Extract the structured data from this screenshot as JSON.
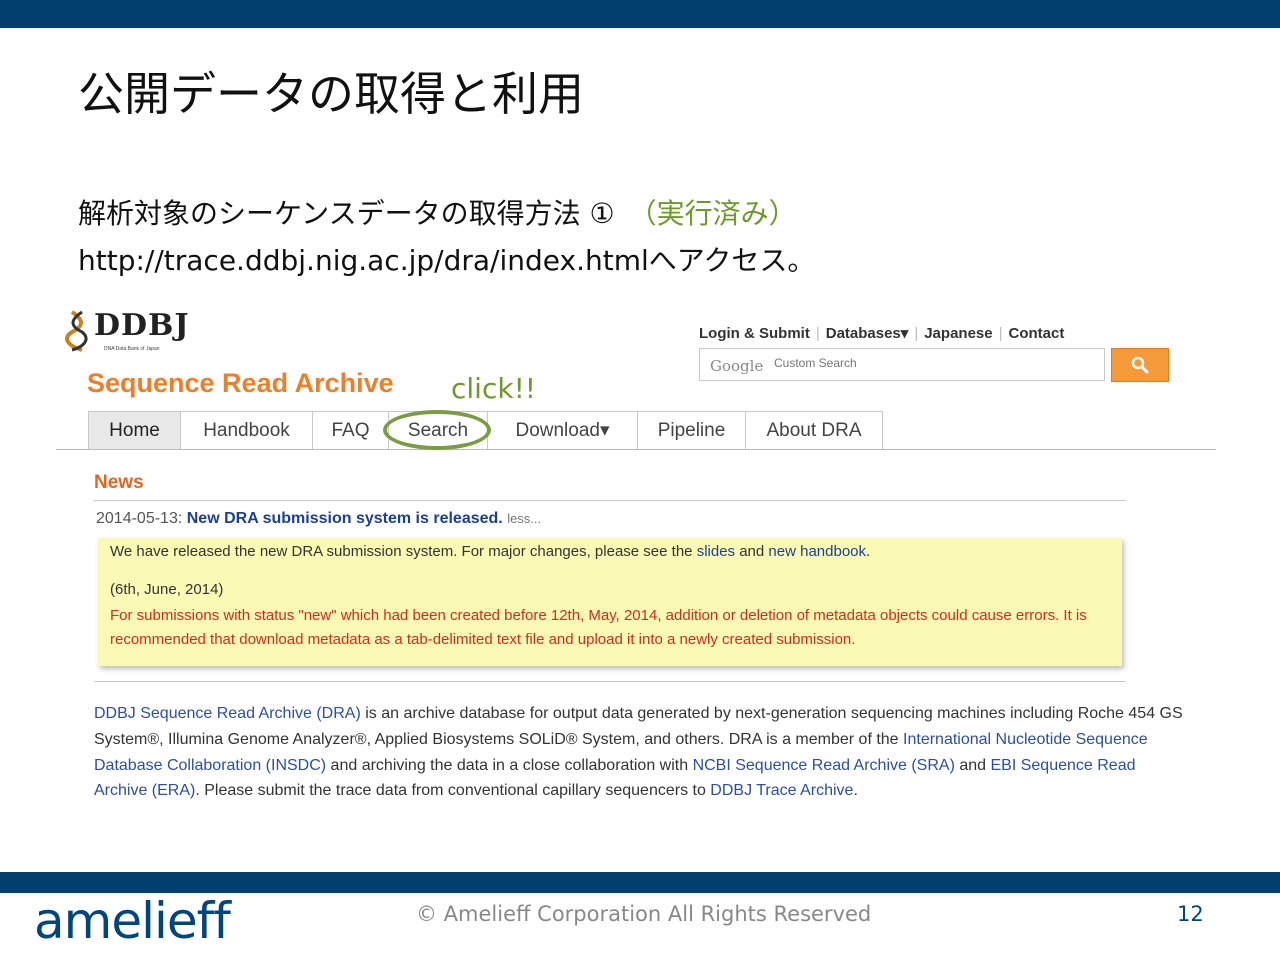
{
  "slide": {
    "title": "公開データの取得と利用",
    "subtitle_main": "解析対象のシーケンスデータの取得方法 ①　",
    "subtitle_note": "（実行済み）",
    "url_line": "http://trace.ddbj.nig.ac.jp/dra/index.htmlへアクセス。",
    "annotation": "click!!"
  },
  "site": {
    "logo_text": "DDBJ",
    "logo_sub": "DNA Data Bank of Japan",
    "top_nav": [
      "Login & Submit",
      "Databases▾",
      "Japanese",
      "Contact"
    ],
    "search": {
      "google_label": "Google",
      "placeholder": "Custom Search"
    },
    "section_title": "Sequence Read Archive",
    "tabs": [
      "Home",
      "Handbook",
      "FAQ",
      "Search",
      "Download▾",
      "Pipeline",
      "About DRA"
    ],
    "news": {
      "heading": "News",
      "date": "2014-05-13:",
      "headline": "New DRA submission system is released.",
      "less": "less...",
      "notice_p1_a": "We have released the new DRA submission system. For major changes, please see the ",
      "notice_link1": "slides",
      "notice_p1_b": " and ",
      "notice_link2": "new handbook",
      "notice_p1_c": ".",
      "notice_date": "(6th, June, 2014)",
      "notice_warning": "For submissions with status \"new\" which had been created before 12th, May, 2014, addition or deletion of metadata objects could cause errors. It is recommended that download metadata as a tab-delimited text file and upload it into a newly created submission."
    },
    "about": {
      "link_dra": "DDBJ Sequence Read Archive (DRA)",
      "t1": " is an archive database for output data generated by next-generation sequencing machines including Roche 454 GS System®, Illumina Genome Analyzer®, Applied Biosystems SOLiD® System, and others. DRA is a member of the ",
      "link_insdc": "International Nucleotide Sequence Database Collaboration (INSDC)",
      "t2": " and archiving the data in a close collaboration with ",
      "link_sra": "NCBI Sequence Read Archive (SRA)",
      "t3": " and ",
      "link_era": "EBI Sequence Read Archive (ERA)",
      "t4": ". Please submit the trace data from conventional capillary sequencers to ",
      "link_trace": "DDBJ Trace Archive",
      "t5": "."
    }
  },
  "footer": {
    "brand": "amelieff",
    "copyright": "© Amelieff Corporation All Rights Reserved",
    "page_number": "12"
  },
  "colors": {
    "bar_blue": "#003f70",
    "accent_orange": "#ee7f2a",
    "annotation_green": "#6e9a2c",
    "link_blue": "#2e4ea0",
    "warning_red": "#d62a1e"
  }
}
